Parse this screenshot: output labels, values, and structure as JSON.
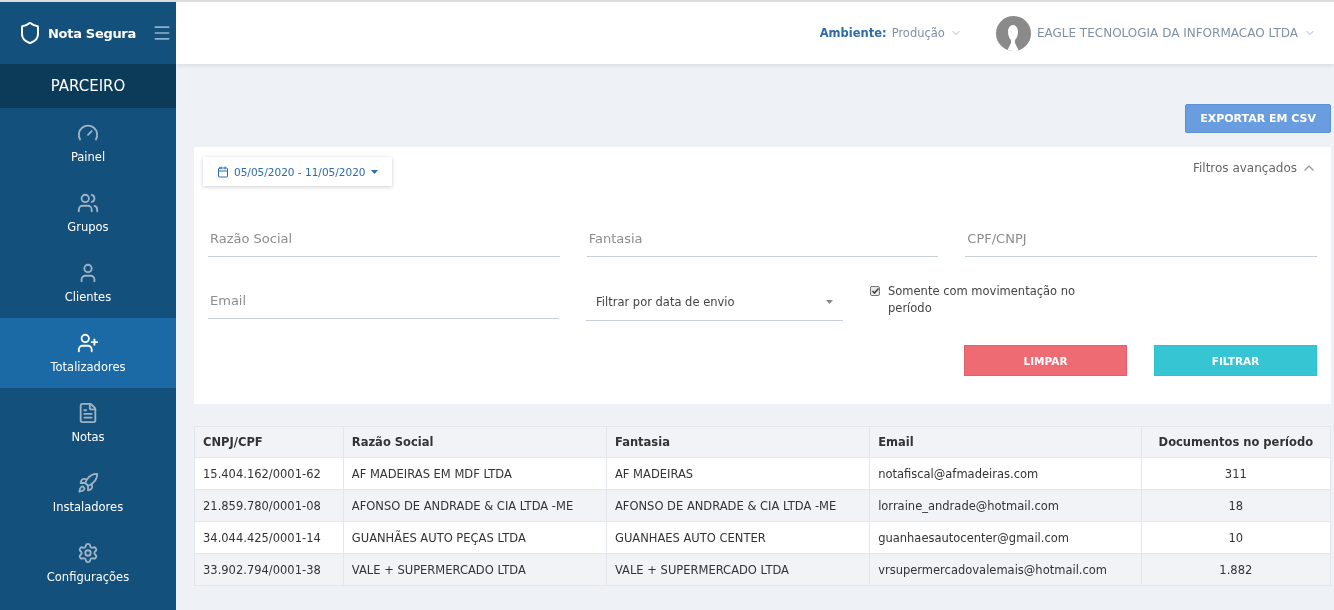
{
  "brand": {
    "name": "Nota Segura"
  },
  "sidebar": {
    "section": "PARCEIRO",
    "items": [
      {
        "label": "Painel",
        "kind": "gauge",
        "selected": false
      },
      {
        "label": "Grupos",
        "kind": "users",
        "selected": false
      },
      {
        "label": "Clientes",
        "kind": "user",
        "selected": false
      },
      {
        "label": "Totalizadores",
        "kind": "userplus",
        "selected": true
      },
      {
        "label": "Notas",
        "kind": "file",
        "selected": false
      },
      {
        "label": "Instaladores",
        "kind": "rocket",
        "selected": false
      },
      {
        "label": "Configurações",
        "kind": "gear",
        "selected": false
      }
    ]
  },
  "header": {
    "environment_label": "Ambiente:",
    "environment_value": "Produção",
    "company": "EAGLE TECNOLOGIA DA INFORMACAO LTDA"
  },
  "export_button": "EXPORTAR EM CSV",
  "filters": {
    "date_range": "05/05/2020 - 11/05/2020",
    "advanced_toggle": "Filtros avançados",
    "expanded": true,
    "fields": [
      {
        "placeholder": "Razão Social"
      },
      {
        "placeholder": "Fantasia"
      },
      {
        "placeholder": "CPF/CNPJ"
      },
      {
        "placeholder": "Email"
      }
    ],
    "date_filter": {
      "placeholder": "Filtrar por data de envio"
    },
    "only_with_movement": {
      "label": "Somente com movimentação no período",
      "checked": true
    },
    "buttons": [
      {
        "label": "LIMPAR",
        "kind": "clear"
      },
      {
        "label": "FILTRAR",
        "kind": "apply"
      }
    ]
  },
  "table": {
    "columns": [
      "CNPJ/CPF",
      "Razão Social",
      "Fantasia",
      "Email",
      "Documentos no período"
    ],
    "rows": [
      [
        "15.404.162/0001-62",
        "AF MADEIRAS EM MDF LTDA",
        "AF MADEIRAS",
        "notafiscal@afmadeiras.com",
        "311"
      ],
      [
        "21.859.780/0001-08",
        "AFONSO DE ANDRADE & CIA LTDA -ME",
        "AFONSO DE ANDRADE & CIA LTDA -ME",
        "lorraine_andrade@hotmail.com",
        "18"
      ],
      [
        "34.044.425/0001-14",
        "GUANHÃES AUTO PEÇAS LTDA",
        "GUANHAES AUTO CENTER",
        "guanhaesautocenter@gmail.com",
        "10"
      ],
      [
        "33.902.794/0001-38",
        "VALE + SUPERMERCADO LTDA",
        "VALE + SUPERMERCADO LTDA",
        "vrsupermercadovalemais@hotmail.com",
        "1.882"
      ]
    ]
  }
}
